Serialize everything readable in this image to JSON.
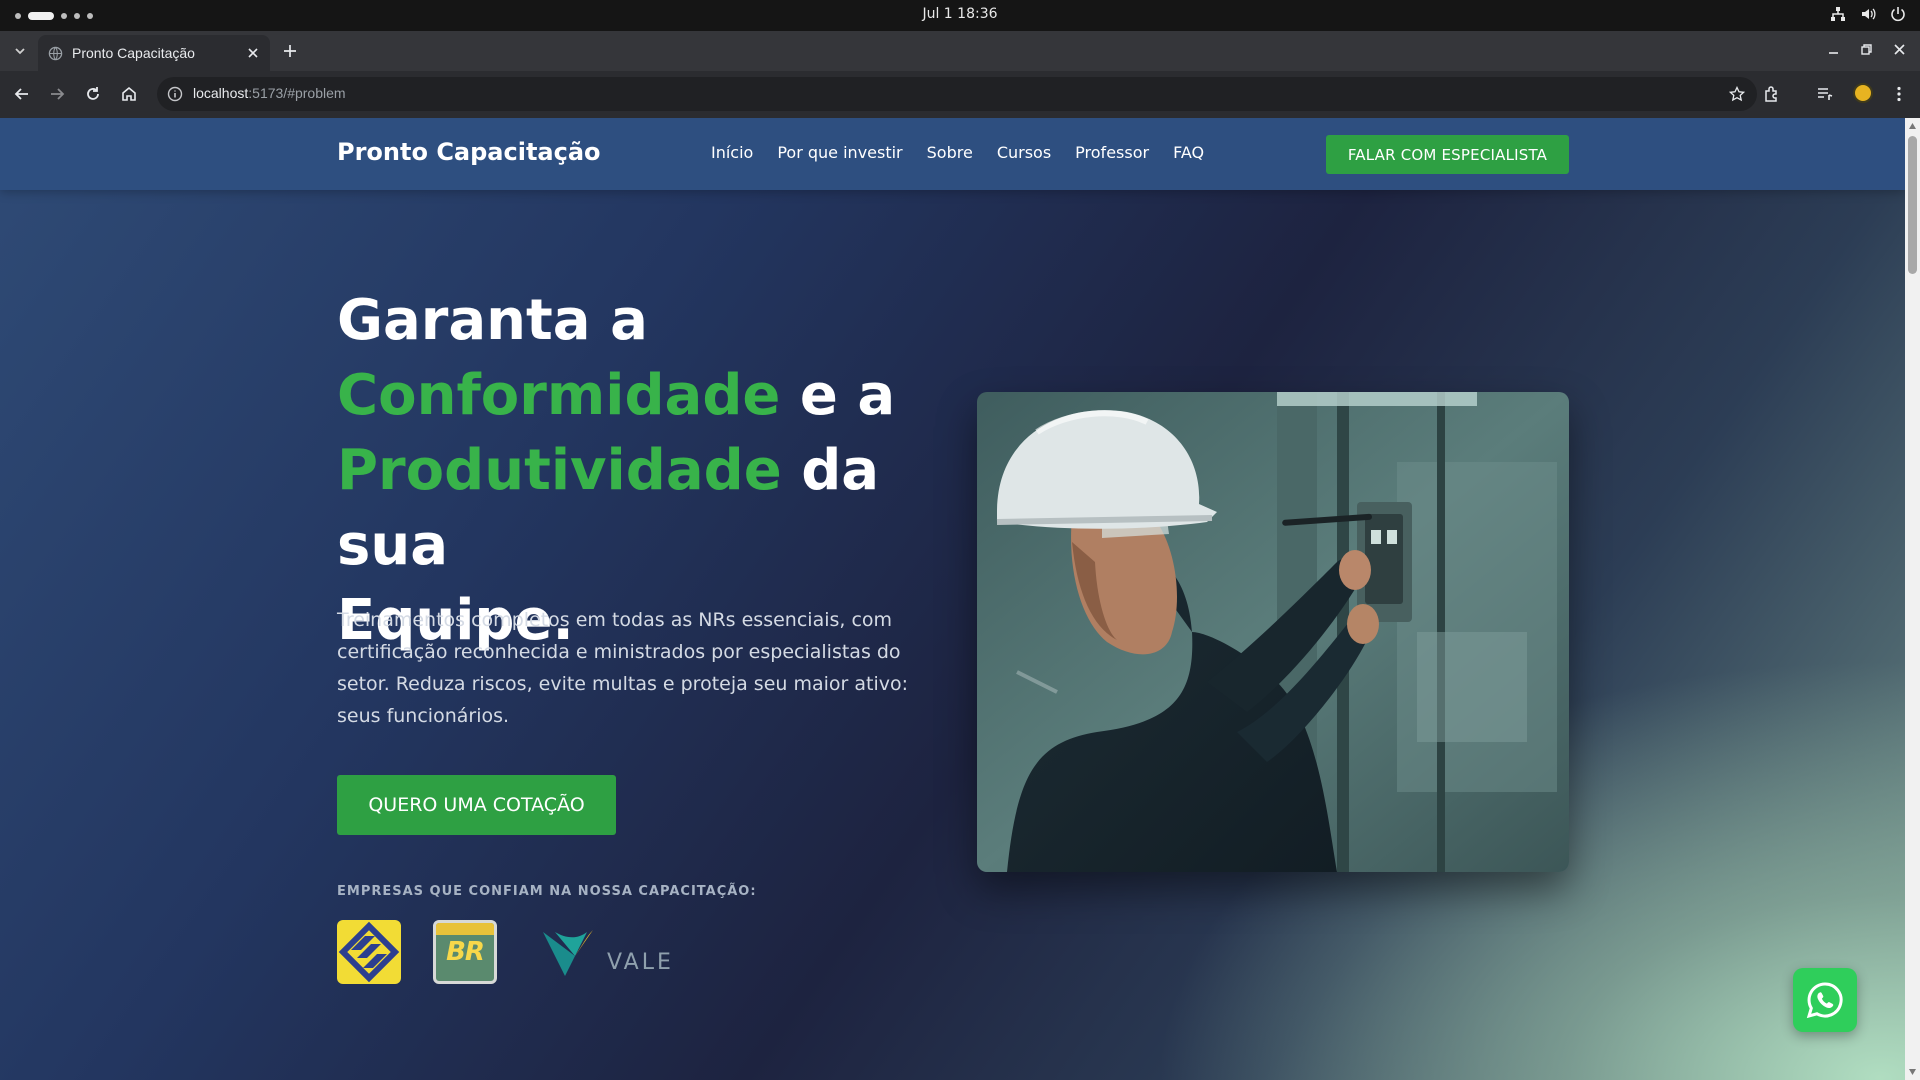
{
  "os": {
    "clock": "Jul 1  18:36"
  },
  "browser": {
    "tab_title": "Pronto Capacitação",
    "url_host": "localhost",
    "url_rest": ":5173/#problem"
  },
  "nav": {
    "brand": "Pronto Capacitação",
    "links": [
      "Início",
      "Por que investir",
      "Sobre",
      "Cursos",
      "Professor",
      "FAQ"
    ],
    "cta": "FALAR COM ESPECIALISTA"
  },
  "hero": {
    "title_1": "Garanta a",
    "title_accent_1": "Conformidade",
    "title_2": " e a",
    "title_accent_2": "Produtividade",
    "title_3": " da sua",
    "title_4": "Equipe.",
    "description": "Treinamentos completos em todas as NRs essenciais, com certificação reconhecida e ministrados por especialistas do setor. Reduza riscos, evite multas e proteja seu maior ativo: seus funcionários.",
    "cta": "QUERO UMA COTAÇÃO",
    "trust_label": "EMPRESAS QUE CONFIAM NA NOSSA CAPACITAÇÃO:",
    "logos": {
      "br_text": "BR",
      "vale_text": "VALE"
    }
  },
  "colors": {
    "accent_green": "#38b34a",
    "button_green": "#2ea043",
    "nav_blue": "#2e4f80",
    "whatsapp_green": "#2fce5b"
  }
}
